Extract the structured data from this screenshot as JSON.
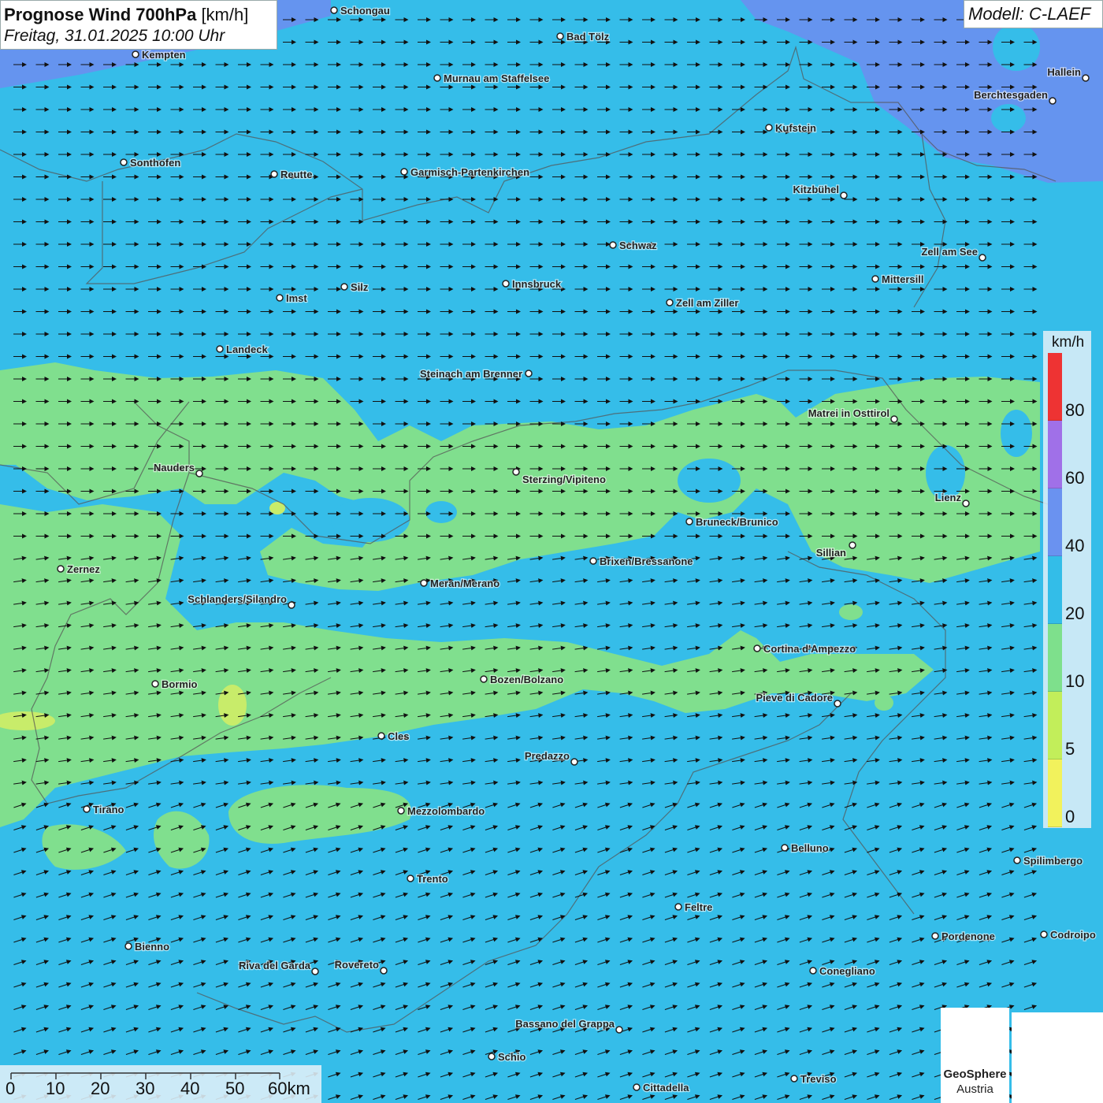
{
  "title": {
    "bold": "Prognose Wind 700hPa",
    "unit": "[km/h]",
    "datetime": "Freitag, 31.01.2025 10:00 Uhr"
  },
  "model": "Modell: C-LAEF",
  "legend": {
    "unit": "km/h",
    "ticks": [
      "80",
      "60",
      "40",
      "20",
      "10",
      "5",
      "0"
    ],
    "colors": [
      "#ee3333",
      "#a070e8",
      "#6a92f0",
      "#33bde8",
      "#7ee08c",
      "#c2ee5a",
      "#f2f25c"
    ]
  },
  "scale": {
    "labels": [
      "0",
      "10",
      "20",
      "30",
      "40",
      "50",
      "60km"
    ]
  },
  "logo": {
    "name": "GeoSphere",
    "sub": "Austria"
  },
  "cities": [
    {
      "name": "Schongau"
    },
    {
      "name": "Bad Tölz"
    },
    {
      "name": "Kempten"
    },
    {
      "name": "Murnau am Staffelsee"
    },
    {
      "name": "Hallein"
    },
    {
      "name": "Berchtesgaden"
    },
    {
      "name": "Kufstein"
    },
    {
      "name": "Sonthofen"
    },
    {
      "name": "Reutte"
    },
    {
      "name": "Garmisch-Partenkirchen"
    },
    {
      "name": "Kitzbühel"
    },
    {
      "name": "Schwaz"
    },
    {
      "name": "Zell am See"
    },
    {
      "name": "Mittersill"
    },
    {
      "name": "Innsbruck"
    },
    {
      "name": "Silz"
    },
    {
      "name": "Imst"
    },
    {
      "name": "Zell am Ziller"
    },
    {
      "name": "Landeck"
    },
    {
      "name": "Steinach am Brenner"
    },
    {
      "name": "Matrei in Osttirol"
    },
    {
      "name": "Nauders"
    },
    {
      "name": "Sterzing/Vipiteno"
    },
    {
      "name": "Lienz"
    },
    {
      "name": "Bruneck/Brunico"
    },
    {
      "name": "Sillian"
    },
    {
      "name": "Brixen/Bressanone"
    },
    {
      "name": "Zernez"
    },
    {
      "name": "Meran/Merano"
    },
    {
      "name": "Schlanders/Silandro"
    },
    {
      "name": "Cortina d'Ampezzo"
    },
    {
      "name": "Bozen/Bolzano"
    },
    {
      "name": "Bormio"
    },
    {
      "name": "Pieve di Cadore"
    },
    {
      "name": "Cles"
    },
    {
      "name": "Predazzo"
    },
    {
      "name": "Tirano"
    },
    {
      "name": "Mezzolombardo"
    },
    {
      "name": "Belluno"
    },
    {
      "name": "Spilimbergo"
    },
    {
      "name": "Trento"
    },
    {
      "name": "Feltre"
    },
    {
      "name": "Pordenone"
    },
    {
      "name": "Codroipo"
    },
    {
      "name": "Bienno"
    },
    {
      "name": "Riva del Garda"
    },
    {
      "name": "Rovereto"
    },
    {
      "name": "Conegliano"
    },
    {
      "name": "Bassano del Grappa"
    },
    {
      "name": "Schio"
    },
    {
      "name": "Treviso"
    },
    {
      "name": "Cittadella"
    }
  ]
}
